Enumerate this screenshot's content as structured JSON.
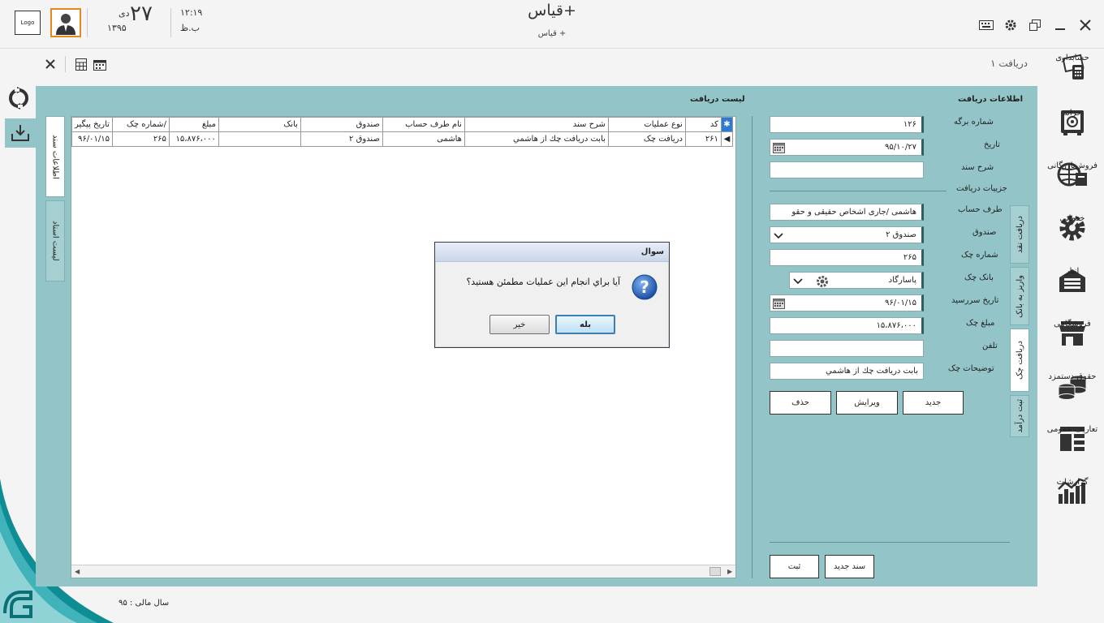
{
  "header": {
    "logo_text": "Logo",
    "day_number": "۲۷",
    "month": "دی",
    "year": "۱۳۹۵",
    "time": "۱۲:۱۹",
    "ampm": "ب.ظ",
    "app_title": "قیاس+",
    "app_subtitle": "قیاس +"
  },
  "toolbar": {
    "tab_title": "دریافت ۱"
  },
  "nav": {
    "items": [
      {
        "label": "حسابداری",
        "icon": "accounting-icon"
      },
      {
        "label": "خزانه",
        "icon": "safe-icon"
      },
      {
        "label": "فروش‌بازرگانی",
        "icon": "globe-sales-icon"
      },
      {
        "label": "خدماتی",
        "icon": "gear-service-icon"
      },
      {
        "label": "انبار",
        "icon": "warehouse-icon"
      },
      {
        "label": "فروشگاهی",
        "icon": "store-icon"
      },
      {
        "label": "حقوق دستمزد",
        "icon": "coins-icon"
      },
      {
        "label": "تعاریف عمومی",
        "icon": "layout-icon"
      },
      {
        "label": "گزارشات",
        "icon": "chart-icon"
      }
    ]
  },
  "form": {
    "section_title": "اطلاعات دریافت",
    "sheet_no_label": "شماره برگه",
    "sheet_no_value": "۱۲۶",
    "date_label": "تاریخ",
    "date_value": "۹۵/۱۰/۲۷",
    "doc_desc_label": "شرح سند",
    "doc_desc_value": "",
    "details_label": "جزییات دریافت",
    "party_label": "طرف حساب",
    "party_value": "هاشمی  /جاری اشخاص حقیقی و حقو",
    "fund_label": "صندوق",
    "fund_value": "صندوق ۲",
    "check_no_label": "شماره چک",
    "check_no_value": "۲۶۵",
    "bank_label": "بانک چک",
    "bank_value": "پاسارگاد",
    "due_date_label": "تاریخ سررسید",
    "due_date_value": "۹۶/۰۱/۱۵",
    "amount_label": "مبلغ چک",
    "amount_value": "۱۵،۸۷۶،۰۰۰",
    "phone_label": "تلفن",
    "phone_value": "",
    "notes_label": "توضیحات چک",
    "notes_value": "بابت دریافت  چك از هاشمي",
    "new_label": "جدید",
    "edit_label": "ویرایش",
    "delete_label": "حذف",
    "new_doc_label": "سند جدید",
    "save_label": "ثبت"
  },
  "right_tabs": [
    "دریافت نقد",
    "واریز به بانک",
    "دریافت چک",
    "ثبت درآمد"
  ],
  "left_tabs": [
    "اطلاعات سند",
    "لیست اسناد"
  ],
  "list": {
    "title": "لیست دریافت",
    "columns": [
      "کد",
      "نوع عملیات",
      "شرح سند",
      "نام طرف حساب",
      "صندوق",
      "بانک",
      "مبلغ",
      "شماره چک/",
      "تاریخ پیگیر"
    ],
    "rows": [
      [
        "۲۶۱",
        "دریافت چک",
        "بابت دریافت  چك از هاشمي",
        "هاشمی",
        "صندوق ۲",
        "",
        "۱۵،۸۷۶،۰۰۰",
        "۲۶۵",
        "۹۶/۰۱/۱۵"
      ]
    ]
  },
  "dialog": {
    "title": "سوال",
    "message": "آیا براي انجام این عملیات مطمئن هستید؟",
    "yes_label": "بله",
    "no_label": "خیر"
  },
  "footer": {
    "fiscal_year": "سال مالی : ۹۵"
  },
  "colors": {
    "panel": "#93c4c8",
    "accent": "#2a7ad6",
    "avatar_border": "#e58a1a"
  }
}
